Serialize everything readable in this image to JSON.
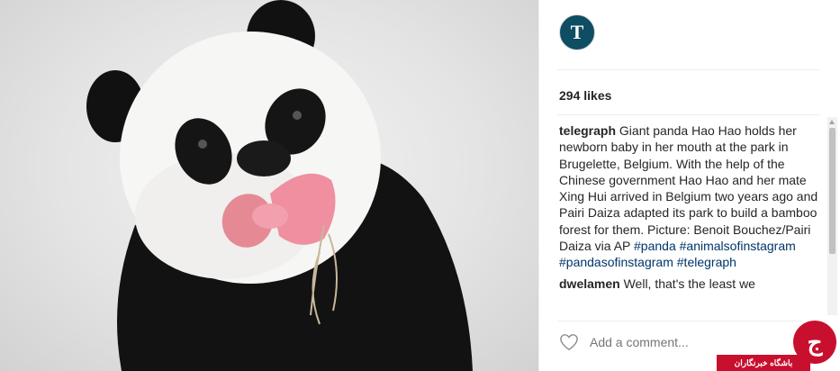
{
  "post": {
    "account": "telegraph",
    "avatar_letter": "T",
    "likes": "294 likes",
    "caption_text": " Giant panda Hao Hao holds her newborn baby in her mouth at the park in Brugelette, Belgium. With the help of the Chinese government Hao Hao and her mate Xing Hui arrived in Belgium two years ago and Pairi Daiza adapted its park to build a bamboo forest for them. Picture: Benoit Bouchez/Pairi Daiza via AP ",
    "hashtags": [
      "#panda",
      "#animalsofinstagram",
      "#pandasofinstagram",
      "#telegraph"
    ],
    "partial_comment_user": "dwelamen",
    "partial_comment_text": " Well, that's the least we"
  },
  "comment_input": {
    "placeholder": "Add a comment..."
  },
  "icons": {
    "like": "heart-outline-icon",
    "avatar": "telegraph-logo-icon"
  },
  "watermark": {
    "text": "باشگاه خبرنگاران",
    "symbol": "ج"
  },
  "colors": {
    "hashtag": "#003569",
    "watermark": "#c8102e",
    "avatar_bg": "#0f4d62"
  }
}
